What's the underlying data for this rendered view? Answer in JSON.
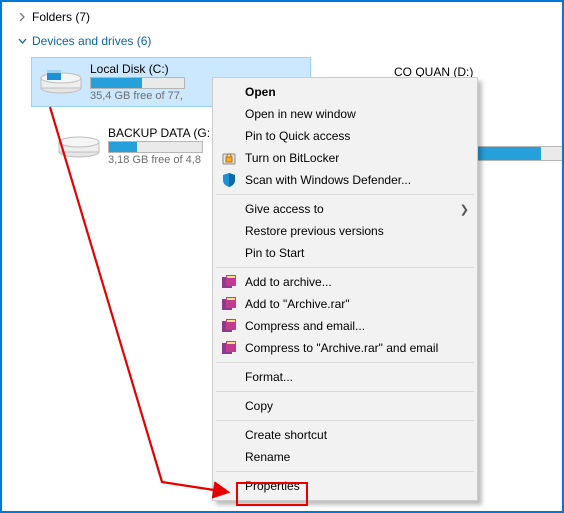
{
  "headers": {
    "folders": "Folders (7)",
    "devices": "Devices and drives (6)"
  },
  "drives": {
    "c": {
      "title": "Local Disk (C:)",
      "sub": "35,4 GB free of 77,",
      "fill_pct": 55
    },
    "d": {
      "title": "CO QUAN (D:)"
    },
    "g": {
      "title": "BACKUP DATA (G:",
      "sub": "3,18 GB free of 4,8",
      "fill_pct": 30
    }
  },
  "menu": {
    "open": "Open",
    "open_new": "Open in new window",
    "pin_quick": "Pin to Quick access",
    "bitlocker": "Turn on BitLocker",
    "defender": "Scan with Windows Defender...",
    "give_access": "Give access to",
    "restore": "Restore previous versions",
    "pin_start": "Pin to Start",
    "add_archive": "Add to archive...",
    "add_rar": "Add to \"Archive.rar\"",
    "compress_email": "Compress and email...",
    "compress_rar_email": "Compress to \"Archive.rar\" and email",
    "format": "Format...",
    "copy": "Copy",
    "shortcut": "Create shortcut",
    "rename": "Rename",
    "properties": "Properties"
  }
}
